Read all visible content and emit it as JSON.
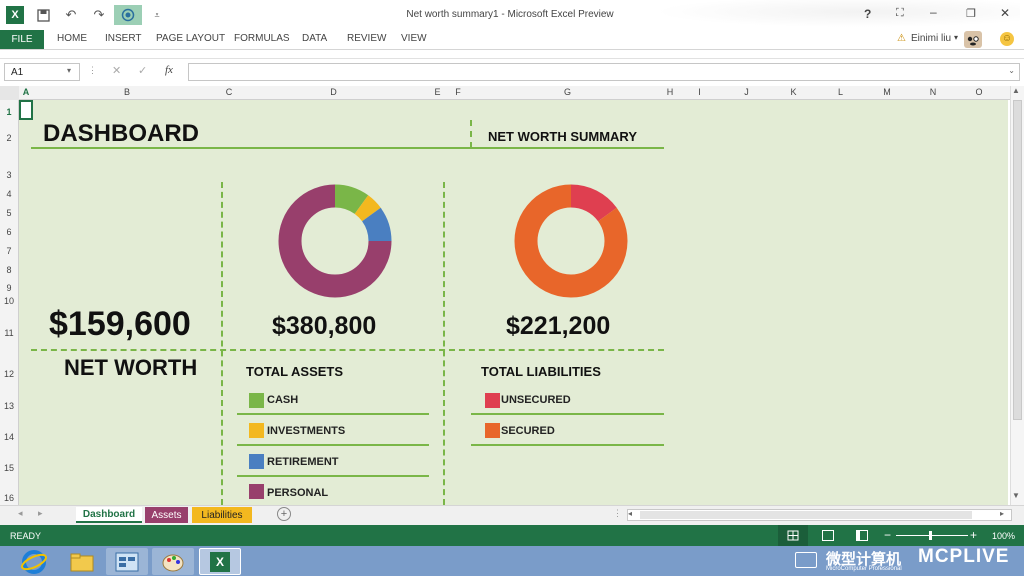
{
  "window": {
    "title": "Net worth summary1 - Microsoft Excel Preview",
    "help": "?",
    "user": "Einimi liu"
  },
  "ribbon": {
    "file": "FILE",
    "tabs": [
      "HOME",
      "INSERT",
      "PAGE LAYOUT",
      "FORMULAS",
      "DATA",
      "REVIEW",
      "VIEW"
    ]
  },
  "formula_bar": {
    "name_box": "A1",
    "fx": "fx",
    "content": ""
  },
  "columns": [
    "A",
    "B",
    "C",
    "D",
    "E",
    "F",
    "G",
    "H",
    "I",
    "J",
    "K",
    "L",
    "M",
    "N",
    "O"
  ],
  "rows": [
    "1",
    "2",
    "3",
    "4",
    "5",
    "6",
    "7",
    "8",
    "9",
    "10",
    "11",
    "12",
    "13",
    "14",
    "15",
    "16"
  ],
  "dashboard": {
    "title": "DASHBOARD",
    "summary_title": "NET WORTH SUMMARY",
    "net_worth_value": "$159,600",
    "net_worth_label": "NET WORTH",
    "assets_value": "$380,800",
    "assets_label": "TOTAL ASSETS",
    "liabilities_value": "$221,200",
    "liabilities_label": "TOTAL LIABILITIES",
    "asset_legend": [
      {
        "label": "CASH",
        "color": "#7ab648"
      },
      {
        "label": "INVESTMENTS",
        "color": "#f3b81f"
      },
      {
        "label": "RETIREMENT",
        "color": "#4a7fc1"
      },
      {
        "label": "PERSONAL",
        "color": "#983f6c"
      }
    ],
    "liability_legend": [
      {
        "label": "UNSECURED",
        "color": "#df3f50"
      },
      {
        "label": "SECURED",
        "color": "#e8662a"
      }
    ]
  },
  "chart_data": [
    {
      "type": "pie",
      "categories": [
        "CASH",
        "INVESTMENTS",
        "RETIREMENT",
        "PERSONAL"
      ],
      "values": [
        10,
        5,
        10,
        75
      ],
      "colors": [
        "#7ab648",
        "#f3b81f",
        "#4a7fc1",
        "#983f6c"
      ]
    },
    {
      "type": "pie",
      "categories": [
        "UNSECURED",
        "SECURED"
      ],
      "values": [
        15,
        85
      ],
      "colors": [
        "#df3f50",
        "#e8662a"
      ]
    }
  ],
  "sheet_tabs": [
    {
      "label": "Dashboard",
      "color": "#ffffff",
      "text": "#217346"
    },
    {
      "label": "Assets",
      "color": "#983f6c",
      "text": "#ffffff"
    },
    {
      "label": "Liabilities",
      "color": "#f3b81f",
      "text": "#222222"
    }
  ],
  "status": {
    "ready": "READY",
    "zoom": "100%"
  },
  "watermark": {
    "cn": "微型计算机",
    "brand": "MCPLIVE",
    "sub": "MicroComputer Professional"
  }
}
